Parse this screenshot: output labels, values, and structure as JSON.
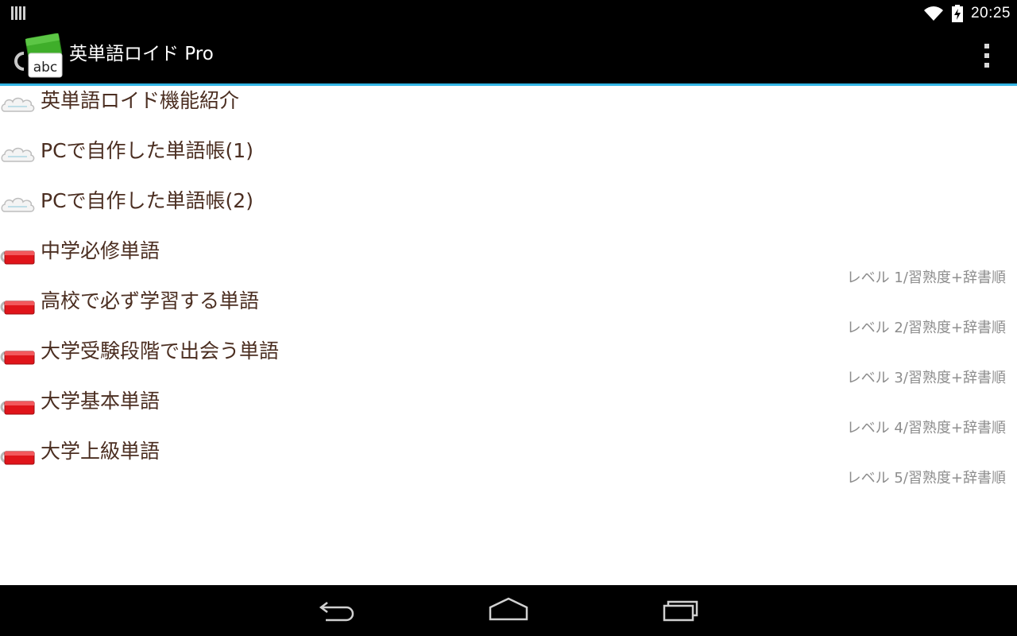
{
  "status_bar": {
    "time": "20:25"
  },
  "action_bar": {
    "title": "英単語ロイド Pro",
    "icon_text": "abc"
  },
  "icons": {
    "cloud": "cloud-icon",
    "tag": "red-tag-icon",
    "wifi": "wifi-icon",
    "battery": "battery-charging-icon",
    "overflow": "overflow-menu-icon"
  },
  "colors": {
    "accent": "#33b5e5",
    "title_text": "#4b2e21",
    "subtitle_text": "#8d8d8d",
    "tag_red": "#e0141a",
    "app_green": "#3fae2a"
  },
  "list": [
    {
      "title": "英単語ロイド機能紹介",
      "subtitle": "",
      "icon": "cloud"
    },
    {
      "title": "PCで自作した単語帳(1)",
      "subtitle": "",
      "icon": "cloud"
    },
    {
      "title": "PCで自作した単語帳(2)",
      "subtitle": "",
      "icon": "cloud"
    },
    {
      "title": "中学必修単語",
      "subtitle": "レベル 1/習熟度+辞書順",
      "icon": "tag"
    },
    {
      "title": "高校で必ず学習する単語",
      "subtitle": "レベル 2/習熟度+辞書順",
      "icon": "tag"
    },
    {
      "title": "大学受験段階で出会う単語",
      "subtitle": "レベル 3/習熟度+辞書順",
      "icon": "tag"
    },
    {
      "title": "大学基本単語",
      "subtitle": "レベル 4/習熟度+辞書順",
      "icon": "tag"
    },
    {
      "title": "大学上級単語",
      "subtitle": "レベル 5/習熟度+辞書順",
      "icon": "tag"
    }
  ]
}
